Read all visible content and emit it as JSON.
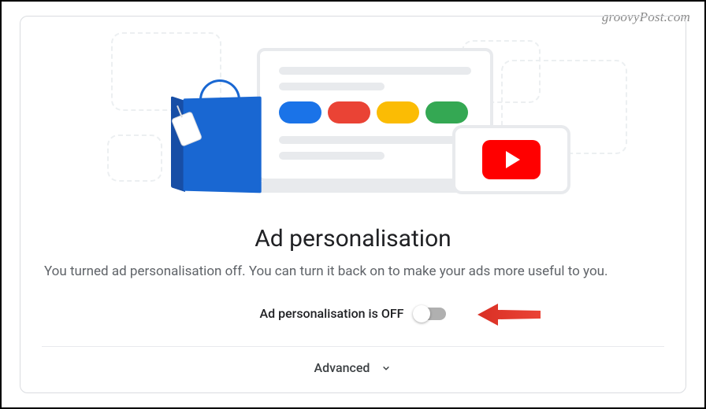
{
  "watermark": "groovyPost.com",
  "heading": "Ad personalisation",
  "description": "You turned ad personalisation off. You can turn it back on to make your ads more useful to you.",
  "toggle": {
    "label": "Ad personalisation is OFF",
    "state": "off"
  },
  "advanced": {
    "label": "Advanced"
  },
  "colors": {
    "blue": "#1a73e8",
    "red": "#ea4335",
    "yellow": "#fbbc04",
    "green": "#34a853",
    "youtube": "#ff0000"
  }
}
